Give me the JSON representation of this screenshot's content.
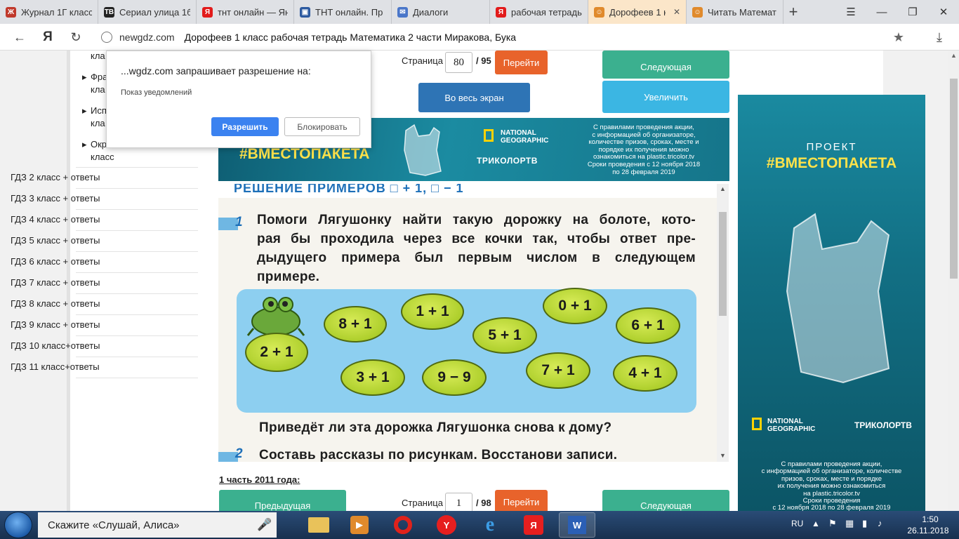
{
  "tabs": [
    {
      "label": "Журнал 1Г класс",
      "fav_color": "#c0392b",
      "fav_glyph": "Ж"
    },
    {
      "label": "Сериал улица 1б",
      "fav_color": "#222222",
      "fav_glyph": "ТВ"
    },
    {
      "label": "тнт онлайн — Ян",
      "fav_color": "#e21b1b",
      "fav_glyph": "Я"
    },
    {
      "label": "ТНТ онлайн. Пр",
      "fav_color": "#2c5aa0",
      "fav_glyph": "▣"
    },
    {
      "label": "Диалоги",
      "fav_color": "#4a76c9",
      "fav_glyph": "✉"
    },
    {
      "label": "рабочая тетрадь",
      "fav_color": "#e21b1b",
      "fav_glyph": "Я"
    },
    {
      "label": "Дорофеев 1 к",
      "fav_color": "#e08a2c",
      "fav_glyph": "☺"
    },
    {
      "label": "Читать Математ",
      "fav_color": "#e08a2c",
      "fav_glyph": "☺"
    }
  ],
  "address": {
    "domain": "newgdz.com",
    "title": "Дорофеев 1 класс рабочая тетрадь Математика 2 части Миракова, Бука"
  },
  "notification": {
    "title": "...wgdz.com запрашивает разрешение на:",
    "body": "Показ уведомлений",
    "allow": "Разрешить",
    "block": "Блокировать"
  },
  "sidebar": {
    "partial": [
      {
        "bullet": "",
        "text": "кла"
      },
      {
        "bullet": "▸",
        "text": "Фра"
      },
      {
        "bullet": "",
        "text": "кла"
      },
      {
        "bullet": "▸",
        "text": "Исп"
      },
      {
        "bullet": "",
        "text": "кла"
      },
      {
        "bullet": "▸",
        "text": "Окр"
      },
      {
        "bullet": "",
        "text": "класс"
      }
    ],
    "items": [
      "ГДЗ 2 класс + ответы",
      "ГДЗ 3 класс + ответы",
      "ГДЗ 4 класс + ответы",
      "ГДЗ 5 класс + ответы",
      "ГДЗ 6 класс + ответы",
      "ГДЗ 7 класс + ответы",
      "ГДЗ 8 класс + ответы",
      "ГДЗ 9 класс + ответы",
      "ГДЗ 10 класс+ответы",
      "ГДЗ 11 класс+ответы"
    ]
  },
  "pager_top": {
    "label": "Страница",
    "page": "80",
    "total": "/ 95",
    "go": "Перейти",
    "next": "Следующая",
    "fullscreen": "Во весь экран",
    "zoom": "Увеличить"
  },
  "banner_top": {
    "hashtag": "#ВМЕСТОПАКЕТА",
    "natgeo": "NATIONAL\nGEOGRAPHIC",
    "tricolor": "ТРИКОЛОРТВ",
    "rules": "С правилами проведения акции,\nс информацией об организаторе,\nколичестве призов, сроках, месте и\nпорядке их получения можно\nознакомиться на plastic.tricolor.tv\nСроки проведения с 12 ноября 2018\nпо 28 февраля 2019"
  },
  "worksheet": {
    "heading": "РЕШЕНИЕ ПРИМЕРОВ  □ + 1,  □ − 1",
    "ex1_num": "1",
    "ex1_lines": [
      "Помоги Лягушонку найти такую дорожку на болоте, кото-",
      "рая бы проходила через все кочки так, чтобы ответ пре-",
      "дыдущего примера был первым числом в следующем",
      "примере."
    ],
    "pads": [
      "2 + 1",
      "8 + 1",
      "1 + 1",
      "5 + 1",
      "0 + 1",
      "6 + 1",
      "3 + 1",
      "9 − 9",
      "7 + 1",
      "4 + 1"
    ],
    "question": "Приведёт ли эта дорожка Лягушонка снова к дому?",
    "ex2_num": "2",
    "ex2_text": "Составь рассказы по рисункам. Восстанови записи."
  },
  "section_title": "1 часть 2011 года:",
  "pager_bottom": {
    "prev": "Предыдущая",
    "label": "Страница",
    "page": "1",
    "total": "/ 98",
    "go": "Перейти",
    "next": "Следующая"
  },
  "banner_right": {
    "project": "ПРОЕКТ",
    "hashtag": "#ВМЕСТОПАКЕТА",
    "natgeo": "NATIONAL\nGEOGRAPHIC",
    "tricolor": "ТРИКОЛОРТВ",
    "rules": "С правилами проведения акции,\nс информацией об организаторе, количестве\nпризов, сроках, месте и порядке\nих получения можно ознакомиться\nна plastic.tricolor.tv\nСроки проведения\nс 12 ноября 2018 по 28 февраля 2019"
  },
  "taskbar": {
    "search": "Скажите «Слушай, Алиса»",
    "lang": "RU",
    "time": "1:50",
    "date": "26.11.2018"
  },
  "colors": {
    "green_btn": "#3bb08f",
    "orange_btn": "#e8632b",
    "blue_btn": "#2e74b5",
    "cyan_btn": "#3bb6e3"
  }
}
